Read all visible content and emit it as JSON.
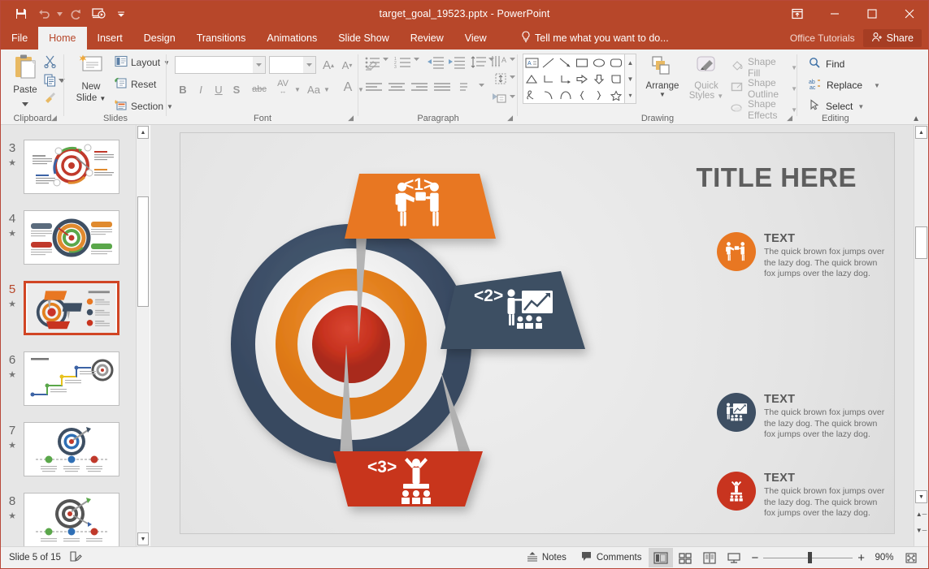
{
  "window": {
    "title": "target_goal_19523.pptx - PowerPoint",
    "quick_access": [
      {
        "name": "save-icon",
        "label": "Save"
      },
      {
        "name": "undo-icon",
        "label": "Undo"
      },
      {
        "name": "redo-icon",
        "label": "Redo"
      },
      {
        "name": "start-presentation-icon",
        "label": "Start From Beginning"
      },
      {
        "name": "customize-qat-icon",
        "label": "Customize Quick Access Toolbar"
      }
    ],
    "controls": [
      {
        "name": "ribbon-display-options-icon",
        "label": "Ribbon Display Options"
      },
      {
        "name": "minimize-icon",
        "label": "Minimize"
      },
      {
        "name": "maximize-icon",
        "label": "Maximize"
      },
      {
        "name": "close-icon",
        "label": "Close"
      }
    ],
    "accent_color": "#b7472a"
  },
  "tabs": [
    {
      "label": "File",
      "active": false
    },
    {
      "label": "Home",
      "active": true
    },
    {
      "label": "Insert",
      "active": false
    },
    {
      "label": "Design",
      "active": false
    },
    {
      "label": "Transitions",
      "active": false
    },
    {
      "label": "Animations",
      "active": false
    },
    {
      "label": "Slide Show",
      "active": false
    },
    {
      "label": "Review",
      "active": false
    },
    {
      "label": "View",
      "active": false
    }
  ],
  "tellme": {
    "label": "Tell me what you want to do...",
    "icon": "lightbulb-icon"
  },
  "account": {
    "user": "Office Tutorials",
    "share_label": "Share"
  },
  "ribbon": {
    "clipboard": {
      "name": "Clipboard",
      "paste": "Paste",
      "items": [
        {
          "label": "Cut",
          "icon": "scissors-icon"
        },
        {
          "label": "Copy",
          "icon": "copy-icon"
        },
        {
          "label": "Format Painter",
          "icon": "format-painter-icon"
        }
      ]
    },
    "slides": {
      "name": "Slides",
      "new_slide": "New\nSlide",
      "new_slide_line1": "New",
      "new_slide_line2": "Slide",
      "items": [
        {
          "label": "Layout",
          "icon": "layout-icon"
        },
        {
          "label": "Reset",
          "icon": "reset-icon"
        },
        {
          "label": "Section",
          "icon": "section-icon"
        }
      ]
    },
    "font": {
      "name": "Font",
      "font_name_value": "",
      "font_size_value": "",
      "buttons": [
        {
          "label": "A",
          "name": "increase-font-size-button"
        },
        {
          "label": "A",
          "name": "decrease-font-size-button"
        },
        {
          "label": "",
          "name": "clear-formatting-button"
        },
        {
          "label": "B",
          "name": "bold-button"
        },
        {
          "label": "I",
          "name": "italic-button"
        },
        {
          "label": "U",
          "name": "underline-button"
        },
        {
          "label": "S",
          "name": "shadow-button"
        },
        {
          "label": "abc",
          "name": "strikethrough-button"
        },
        {
          "label": "AV",
          "name": "character-spacing-button"
        },
        {
          "label": "Aa",
          "name": "change-case-button"
        },
        {
          "label": "A",
          "name": "font-color-button"
        }
      ]
    },
    "paragraph": {
      "name": "Paragraph"
    },
    "drawing": {
      "name": "Drawing",
      "arrange": "Arrange",
      "quick_styles_line1": "Quick",
      "quick_styles_line2": "Styles",
      "shape_fill": "Shape Fill",
      "shape_outline": "Shape Outline",
      "shape_effects": "Shape Effects"
    },
    "editing": {
      "name": "Editing",
      "items": [
        {
          "label": "Find",
          "icon": "search-icon"
        },
        {
          "label": "Replace",
          "icon": "replace-icon"
        },
        {
          "label": "Select",
          "icon": "cursor-icon"
        }
      ]
    }
  },
  "slide_panel": {
    "thumbnails": [
      {
        "number": "3",
        "selected": false,
        "style": "dartboard-cycle"
      },
      {
        "number": "4",
        "selected": false,
        "style": "dartboard-callouts"
      },
      {
        "number": "5",
        "selected": true,
        "style": "target-flags"
      },
      {
        "number": "6",
        "selected": false,
        "style": "staircase"
      },
      {
        "number": "7",
        "selected": false,
        "style": "dartboard-blue"
      },
      {
        "number": "8",
        "selected": false,
        "style": "dartboard-gray"
      }
    ]
  },
  "slide": {
    "title": "TITLE HERE",
    "callouts": [
      {
        "label": "<1>",
        "color": "#e87722",
        "icon": "two-people-icon"
      },
      {
        "label": "<2>",
        "color": "#3e4f63",
        "icon": "presenter-chart-icon"
      },
      {
        "label": "<3>",
        "color": "#c8341f",
        "icon": "podium-winner-icon"
      }
    ],
    "text_blocks": [
      {
        "heading": "TEXT",
        "body": "The quick brown fox jumps over the lazy dog. The quick brown fox jumps over the lazy dog.",
        "color": "#e87722",
        "icon": "two-people-icon"
      },
      {
        "heading": "TEXT",
        "body": "The quick brown fox jumps over the lazy dog. The quick brown fox jumps over the lazy dog.",
        "color": "#3e4f63",
        "icon": "presenter-chart-icon"
      },
      {
        "heading": "TEXT",
        "body": "The quick brown fox jumps over the lazy dog. The quick brown fox jumps over the lazy dog.",
        "color": "#c8341f",
        "icon": "podium-winner-icon"
      }
    ],
    "target_colors": {
      "ring_outer": "#3e4f63",
      "ring_white": "#f4f4f4",
      "ring_orange": "#e2801e",
      "center": "#c9332a"
    }
  },
  "statusbar": {
    "slide_indicator": "Slide 5 of 15",
    "notes_page_icon": "notes-page-icon",
    "notes_label": "Notes",
    "comments_label": "Comments",
    "views": [
      {
        "name": "normal-view-button",
        "active": true
      },
      {
        "name": "slide-sorter-view-button",
        "active": false
      },
      {
        "name": "reading-view-button",
        "active": false
      },
      {
        "name": "slideshow-view-button",
        "active": false
      }
    ],
    "zoom_out": "−",
    "zoom_in": "+",
    "zoom_level": "90%",
    "fit_label": "Fit slide to current window"
  }
}
